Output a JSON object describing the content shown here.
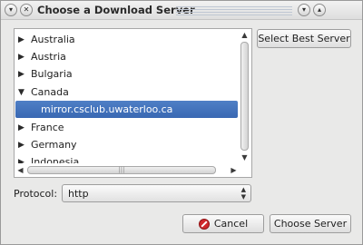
{
  "window": {
    "title": "Choose a Download Server",
    "title_buttons": [
      "menu",
      "close",
      "minimize",
      "maximize"
    ]
  },
  "servers": [
    {
      "label": "Australia",
      "expanded": false
    },
    {
      "label": "Austria",
      "expanded": false
    },
    {
      "label": "Bulgaria",
      "expanded": false
    },
    {
      "label": "Canada",
      "expanded": true
    },
    {
      "label": "mirror.csclub.uwaterloo.ca",
      "child": true,
      "selected": true
    },
    {
      "label": "France",
      "expanded": false
    },
    {
      "label": "Germany",
      "expanded": false
    },
    {
      "label": "Indonesia",
      "expanded": false
    }
  ],
  "select_best_label": "Select Best Server",
  "protocol": {
    "label": "Protocol:",
    "value": "http"
  },
  "actions": {
    "cancel_label": "Cancel",
    "choose_label": "Choose Server"
  },
  "colors": {
    "selection": "#3f6fb8",
    "cancel_icon": "#d0292c"
  }
}
